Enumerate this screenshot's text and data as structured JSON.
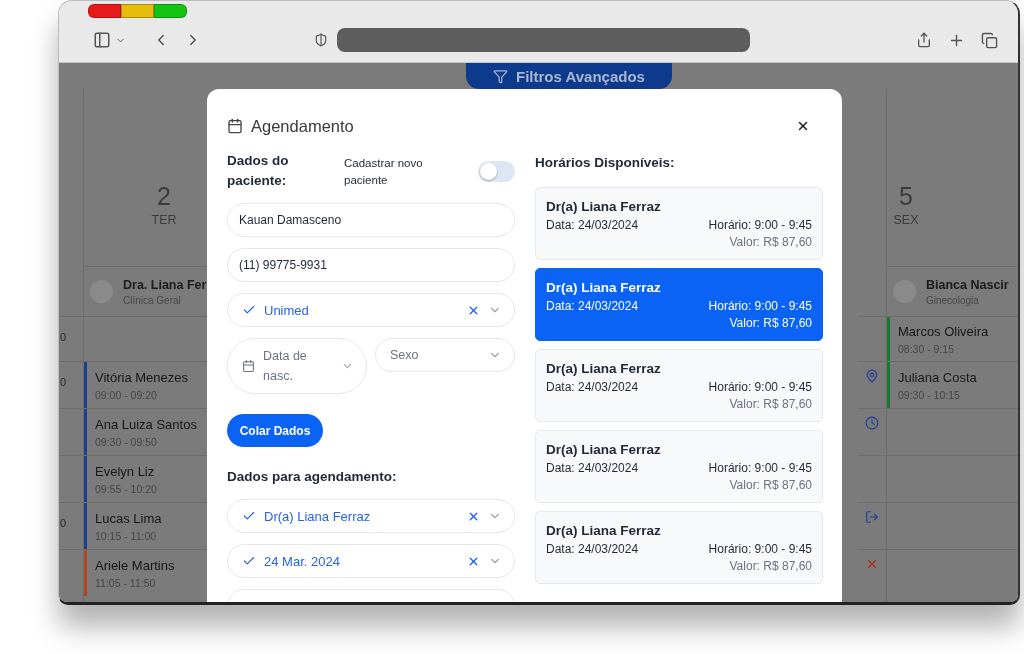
{
  "filter_button": {
    "label": "Filtros Avançados"
  },
  "calendar": {
    "rows": [
      {
        "gutter": "0"
      },
      {
        "gutter": "0"
      },
      {},
      {},
      {
        "gutter": "0"
      },
      {}
    ],
    "days": [
      {
        "number": "2",
        "weekday": "TER",
        "doctor": {
          "name": "Dra. Liana Fer",
          "specialty": "Clínica Geral"
        },
        "slots": [
          {
            "kind": "free"
          },
          {
            "kind": "appointment",
            "name": "Vitória Menezes",
            "time": "09:00 - 09:20",
            "color": "#1e3f8f"
          },
          {
            "kind": "appointment",
            "name": "Ana Luiza Santos",
            "time": "09:30 - 09:50",
            "color": "#1e3f8f"
          },
          {
            "kind": "appointment",
            "name": "Evelyn Liz",
            "time": "09:55 - 10:20",
            "color": "#1e3f8f"
          },
          {
            "kind": "appointment",
            "name": "Lucas Lima",
            "time": "10:15 - 11:00",
            "color": "#1e3f8f"
          },
          {
            "kind": "appointment",
            "name": "Ariele Martins",
            "time": "11:05 - 11:50",
            "color": "#b04a1c"
          }
        ]
      },
      {
        "number": "5",
        "weekday": "SEX",
        "doctor": {
          "name": "Bianca Nascir",
          "specialty": "Ginecologia"
        },
        "slots": [
          {
            "kind": "appointment",
            "name": "Marcos Oliveira",
            "time": "08:30 - 9:15",
            "color": "#1b7a2c"
          },
          {
            "kind": "appointment",
            "name": "Juliana Costa",
            "time": "09:30 - 10:15",
            "color": "#1b7a2c"
          },
          {
            "kind": "free"
          },
          {
            "kind": "free"
          },
          {
            "kind": "free"
          },
          {
            "kind": "free"
          }
        ]
      }
    ]
  },
  "modal": {
    "title": "Agendamento",
    "patient": {
      "title": "Dados do paciente:",
      "new_patient_label": "Cadastrar novo paciente",
      "new_patient_on": false,
      "name": "Kauan Damasceno",
      "phone": "(11) 99775-9931",
      "insurance": "Unimed",
      "birth_placeholder": "Data de nasc.",
      "sex_placeholder": "Sexo",
      "paste_button": "Colar Dados"
    },
    "booking": {
      "title": "Dados para agendamento:",
      "fields": [
        {
          "value": "Dr(a) Liana Ferraz"
        },
        {
          "value": "24 Mar. 2024"
        }
      ]
    },
    "slots_title": "Horários Disponíveis:",
    "slots": [
      {
        "doctor": "Dr(a) Liana Ferraz",
        "date": "Data: 24/03/2024",
        "time": "Horário: 9:00 - 9:45",
        "price": "Valor: R$ 87,60",
        "selected": false
      },
      {
        "doctor": "Dr(a) Liana Ferraz",
        "date": "Data: 24/03/2024",
        "time": "Horário: 9:00 - 9:45",
        "price": "Valor: R$ 87,60",
        "selected": true
      },
      {
        "doctor": "Dr(a) Liana Ferraz",
        "date": "Data: 24/03/2024",
        "time": "Horário: 9:00 - 9:45",
        "price": "Valor: R$ 87,60",
        "selected": false
      },
      {
        "doctor": "Dr(a) Liana Ferraz",
        "date": "Data: 24/03/2024",
        "time": "Horário: 9:00 - 9:45",
        "price": "Valor: R$ 87,60",
        "selected": false
      },
      {
        "doctor": "Dr(a) Liana Ferraz",
        "date": "Data: 24/03/2024",
        "time": "Horário: 9:00 - 9:45",
        "price": "Valor: R$ 87,60",
        "selected": false
      }
    ]
  }
}
